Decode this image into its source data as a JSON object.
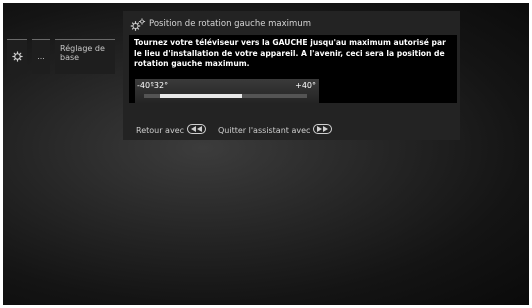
{
  "side_menu": {
    "gear_icon": "gear-icon",
    "dots_label": "...",
    "item_label": "Réglage de base"
  },
  "dialog": {
    "title_icon": "gears-icon",
    "title": "Position de rotation gauche maximum",
    "message": "Tournez votre téléviseur vers la GAUCHE jusqu'au maximum autorisé par le lieu d'installation de votre appareil. A l'avenir, ceci sera la position de rotation gauche maximum.",
    "slider": {
      "min_label": "-40°",
      "current_label": "-32°",
      "max_label": "+40°",
      "min": -40,
      "max": 40,
      "range_start": -32,
      "range_end": 8
    },
    "help": {
      "back_label": "Retour avec",
      "back_key_icon": "rewind-key-icon",
      "quit_label": "Quitter l'assistant avec",
      "quit_key_icon": "fast-forward-key-icon"
    }
  },
  "colors": {
    "dialog_bg": "#232323",
    "body_bg": "#000000",
    "track": "#545454",
    "track_fill": "#e8e8e8"
  }
}
